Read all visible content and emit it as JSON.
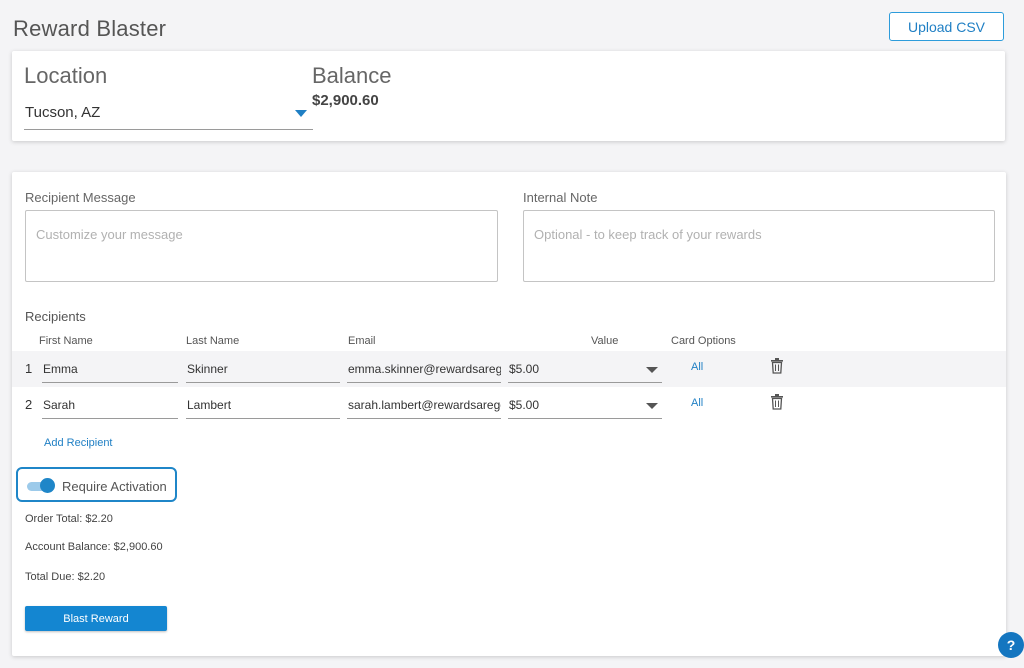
{
  "header": {
    "title": "Reward Blaster",
    "upload_label": "Upload CSV"
  },
  "location": {
    "label": "Location",
    "value": "Tucson, AZ"
  },
  "balance": {
    "label": "Balance",
    "value": "$2,900.60"
  },
  "message": {
    "label": "Recipient Message",
    "placeholder": "Customize your message"
  },
  "note": {
    "label": "Internal Note",
    "placeholder": "Optional - to keep track of your rewards"
  },
  "recipients": {
    "label": "Recipients",
    "columns": [
      "First Name",
      "Last Name",
      "Email",
      "Value",
      "Card Options"
    ],
    "rows": [
      {
        "num": "1",
        "first": "Emma",
        "last": "Skinner",
        "email": "emma.skinner@rewardsaregc",
        "value": "$5.00",
        "options": "All"
      },
      {
        "num": "2",
        "first": "Sarah",
        "last": "Lambert",
        "email": "sarah.lambert@rewardsaregc",
        "value": "$5.00",
        "options": "All"
      }
    ],
    "add_label": "Add Recipient"
  },
  "activation": {
    "label": "Require Activation",
    "enabled": true
  },
  "summary": {
    "order_total": "Order Total: $2.20",
    "account_balance": "Account Balance: $2,900.60",
    "total_due": "Total Due: $2.20"
  },
  "actions": {
    "blast_label": "Blast Reward",
    "help_label": "?"
  },
  "colors": {
    "accent": "#1486d1",
    "toggle_track": "#9ccaea",
    "background": "#f4f4f6"
  },
  "icons": {
    "delete": "trash-icon",
    "dropdown": "chevron-down-icon"
  }
}
